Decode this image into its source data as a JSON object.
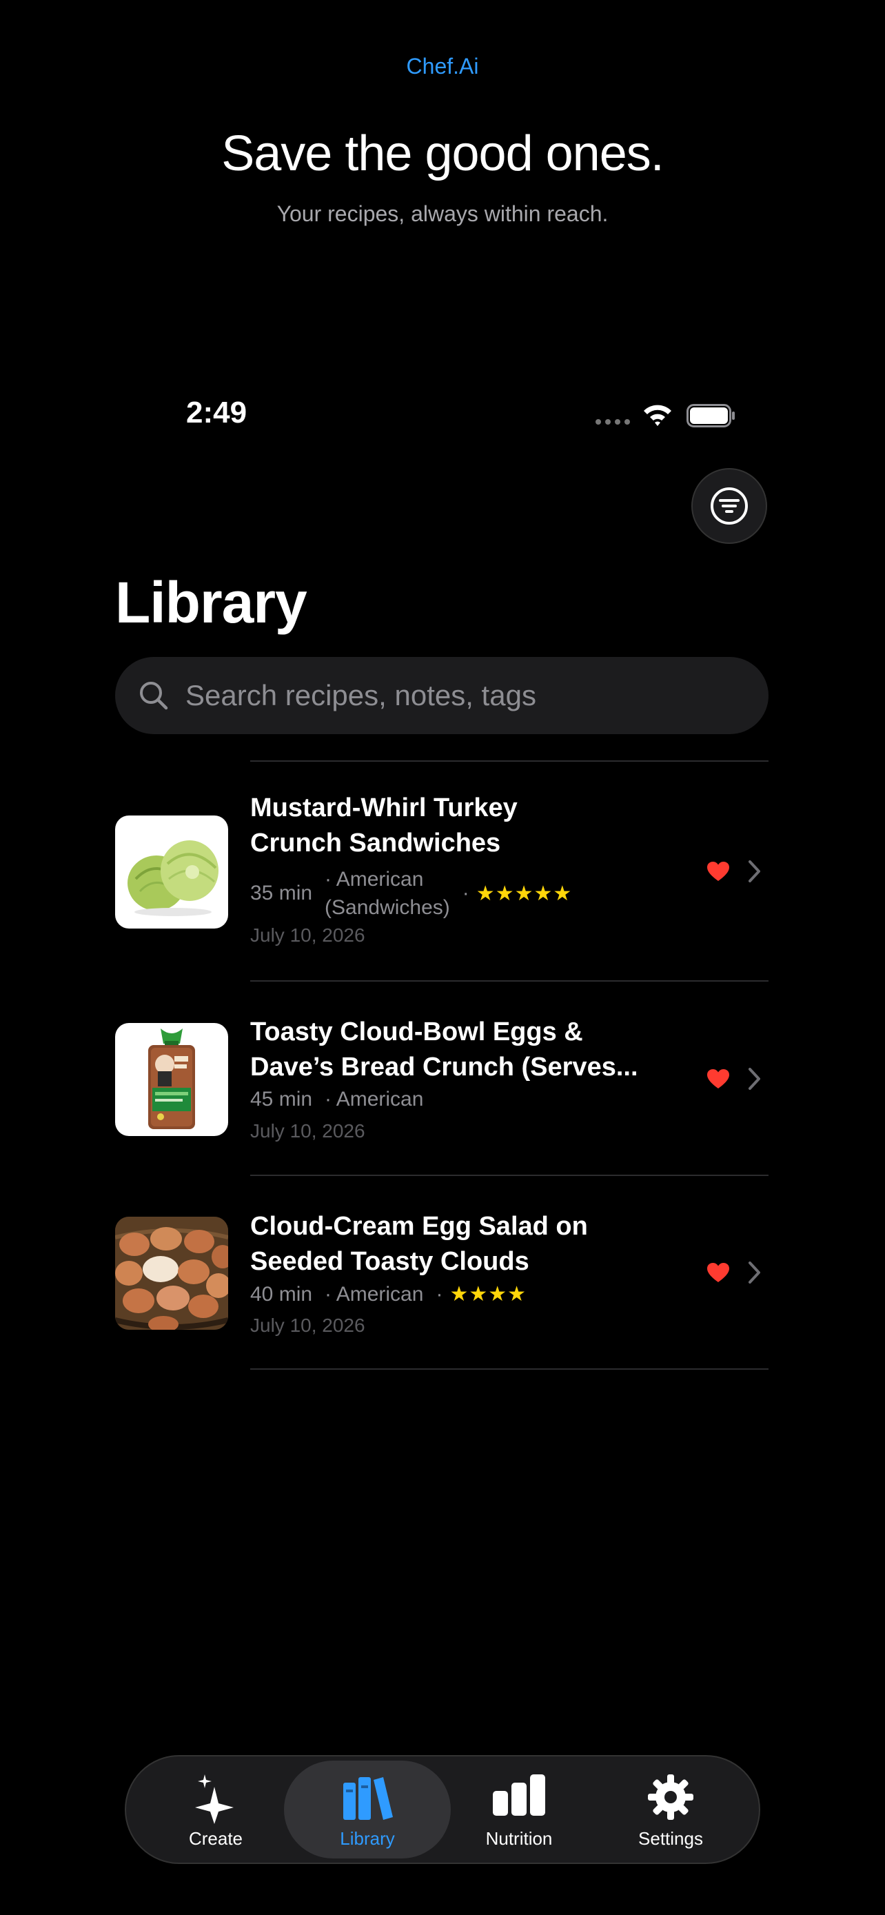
{
  "header": {
    "brand": "Chef.Ai",
    "headline": "Save the good ones.",
    "subheadline": "Your recipes, always within reach."
  },
  "status_bar": {
    "time": "2:49",
    "icons": [
      "cellular-dots-icon",
      "wifi-icon",
      "battery-icon"
    ]
  },
  "toolbar": {
    "filter_icon": "filter-icon"
  },
  "page": {
    "title": "Library"
  },
  "search": {
    "placeholder": "Search recipes, notes, tags",
    "value": ""
  },
  "recipes": [
    {
      "title_line1": "Mustard-Whirl Turkey",
      "title_line2": "Crunch Sandwiches",
      "time": "35 min",
      "cuisine_line1": "· American",
      "cuisine_line2": "(Sandwiches)",
      "rating_stars": "★★★★★",
      "rating": 5,
      "date": "July 10, 2026",
      "favorite": true,
      "image": "lettuce"
    },
    {
      "title_line1": "Toasty Cloud-Bowl Eggs &",
      "title_line2": "Dave’s Bread Crunch (Serves...",
      "time": "45 min",
      "cuisine_line1": "· American",
      "date": "July 10, 2026",
      "favorite": true,
      "image": "bread-bag"
    },
    {
      "title_line1": "Cloud-Cream Egg Salad on",
      "title_line2": "Seeded Toasty Clouds",
      "time": "40 min",
      "cuisine_line1": "· American",
      "rating_stars": "★★★★",
      "rating": 4,
      "date": "July 10, 2026",
      "favorite": true,
      "image": "eggs-basket"
    }
  ],
  "tabbar": {
    "active": "Library",
    "tabs": [
      {
        "label": "Create",
        "icon": "sparkles-icon"
      },
      {
        "label": "Library",
        "icon": "books-icon"
      },
      {
        "label": "Nutrition",
        "icon": "bar-chart-icon"
      },
      {
        "label": "Settings",
        "icon": "gear-icon"
      }
    ]
  },
  "colors": {
    "background": "#000000",
    "accent": "#2f9bff",
    "heart": "#ff3b30",
    "star": "#ffd60a",
    "surface": "#1c1c1e"
  }
}
